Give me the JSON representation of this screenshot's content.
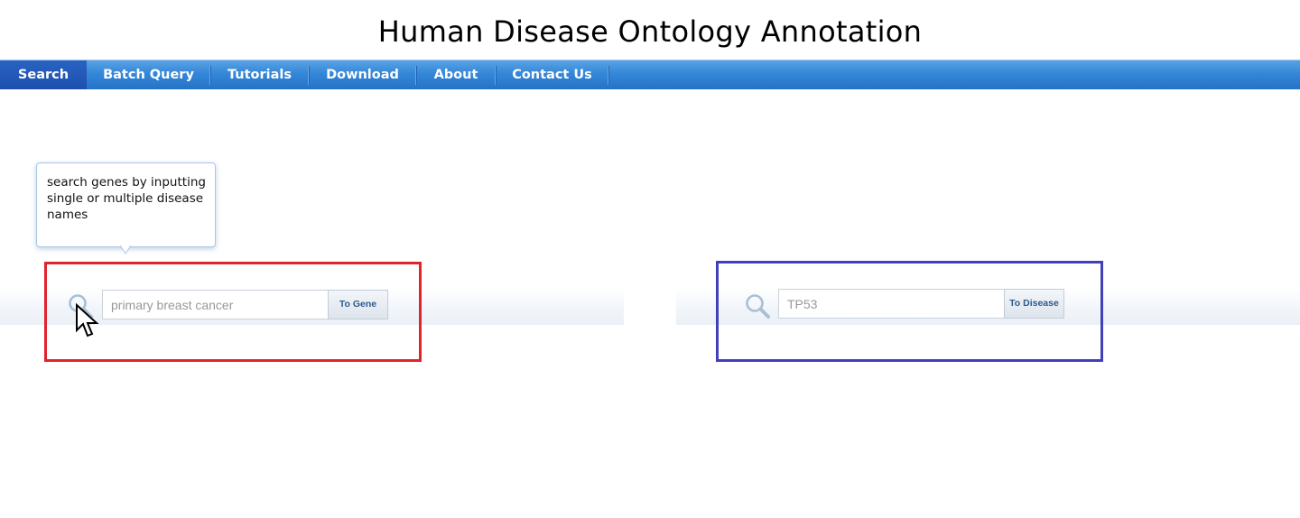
{
  "site": {
    "title": "Human Disease Ontology Annotation"
  },
  "nav": {
    "items": [
      {
        "label": "Search",
        "active": true
      },
      {
        "label": "Batch Query",
        "active": false
      },
      {
        "label": "Tutorials",
        "active": false
      },
      {
        "label": "Download",
        "active": false
      },
      {
        "label": "About",
        "active": false
      },
      {
        "label": "Contact Us",
        "active": false
      }
    ]
  },
  "tooltip": {
    "text": "search genes by inputting single or multiple disease names"
  },
  "search_disease": {
    "icon": "search-icon",
    "value": "primary breast cancer",
    "button_label": "To Gene",
    "highlight_color": "#e0242c"
  },
  "search_gene": {
    "icon": "search-icon",
    "value": "TP53",
    "button_label": "To Disease",
    "highlight_color": "#4040b8"
  },
  "colors": {
    "nav_gradient_top": "#5aa2e4",
    "nav_gradient_bottom": "#2472c6",
    "nav_active": "#1d4fae",
    "button_text": "#2c5a8c"
  }
}
